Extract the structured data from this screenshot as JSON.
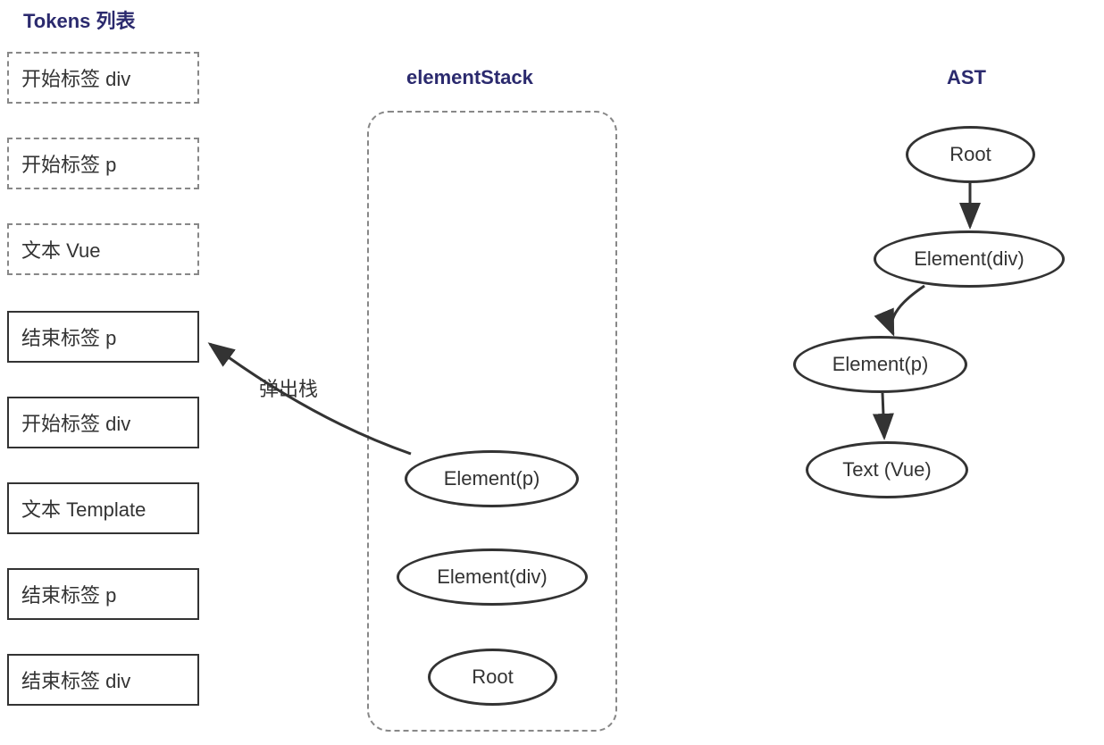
{
  "titles": {
    "tokens": "Tokens 列表",
    "stack": "elementStack",
    "ast": "AST"
  },
  "tokens": [
    {
      "label": "开始标签 div",
      "style": "dashed"
    },
    {
      "label": "开始标签 p",
      "style": "dashed"
    },
    {
      "label": "文本 Vue",
      "style": "dashed"
    },
    {
      "label": "结束标签 p",
      "style": "solid"
    },
    {
      "label": "开始标签 div",
      "style": "solid"
    },
    {
      "label": "文本 Template",
      "style": "solid"
    },
    {
      "label": "结束标签 p",
      "style": "solid"
    },
    {
      "label": "结束标签 div",
      "style": "solid"
    }
  ],
  "arrow_label": "弹出栈",
  "stack": [
    {
      "label": "Element(p)"
    },
    {
      "label": "Element(div)"
    },
    {
      "label": "Root"
    }
  ],
  "ast": [
    {
      "label": "Root"
    },
    {
      "label": "Element(div)"
    },
    {
      "label": "Element(p)"
    },
    {
      "label": "Text (Vue)"
    }
  ]
}
